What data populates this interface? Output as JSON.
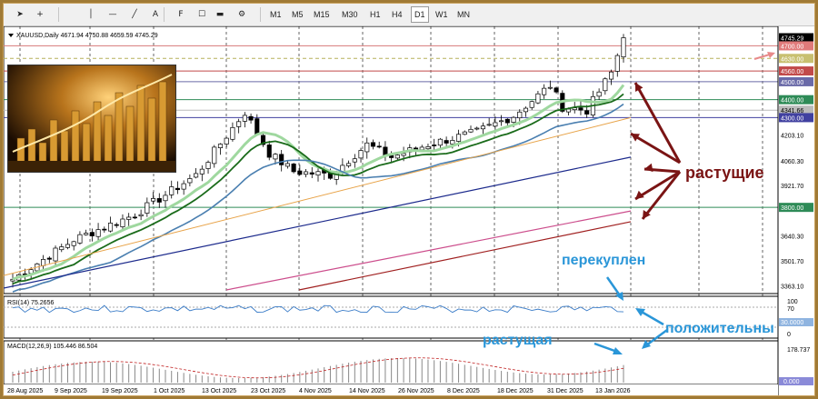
{
  "toolbar": {
    "timeframes": [
      "M1",
      "M5",
      "M15",
      "M30",
      "H1",
      "H4",
      "D1",
      "W1",
      "MN"
    ],
    "active_timeframe": "D1",
    "tools": [
      "cursor-icon",
      "crosshair-icon",
      "vertical-line-icon",
      "horizontal-line-icon",
      "trend-line-icon",
      "text-label-icon",
      "fibonacci-icon",
      "object-list-icon",
      "indicator-icon",
      "drawing-menu-icon"
    ]
  },
  "chart": {
    "header": "XAUUSD,Daily  4671.94 4750.88 4659.59 4745.29",
    "price_labels": [
      "4745.29",
      "4700.00",
      "4630.00",
      "4560.00",
      "4500.00",
      "4400.00",
      "4341.66",
      "4300.00",
      "4203.10",
      "4060.30",
      "3921.70",
      "3800.00",
      "3640.30",
      "3501.70",
      "3363.10"
    ],
    "date_labels": [
      "28 Aug 2025",
      "9 Sep 2025",
      "19 Sep 2025",
      "1 Oct 2025",
      "13 Oct 2025",
      "23 Oct 2025",
      "4 Nov 2025",
      "14 Nov 2025",
      "26 Nov 2025",
      "8 Dec 2025",
      "18 Dec 2025",
      "31 Dec 2025",
      "13 Jan 2026"
    ],
    "colors": {
      "bull": "#ffffff",
      "bear": "#000000",
      "ma_fast": "#1a6b1a",
      "ma_light": "#9fd89f",
      "ma_blue": "#4a7fb0",
      "ma_orange": "#e8a44a",
      "ma_navy": "#1c2a8c",
      "ma_pink": "#cc4d8c",
      "ma_red": "#a02020",
      "annotation_dark": "#7a1414",
      "annotation_blue": "#2a96d8"
    }
  },
  "annotations": {
    "rising_plural": "растущие",
    "overbought": "перекуплен",
    "rising_single": "растущая",
    "positive": "положительны"
  },
  "rsi": {
    "label": "RSI(14) 75.2656",
    "levels": [
      "100",
      "70",
      "30.0000",
      "0"
    ]
  },
  "macd": {
    "label": "MACD(12,26,9) 105.446 86.504",
    "levels": [
      "178.737",
      "0.000"
    ]
  }
}
